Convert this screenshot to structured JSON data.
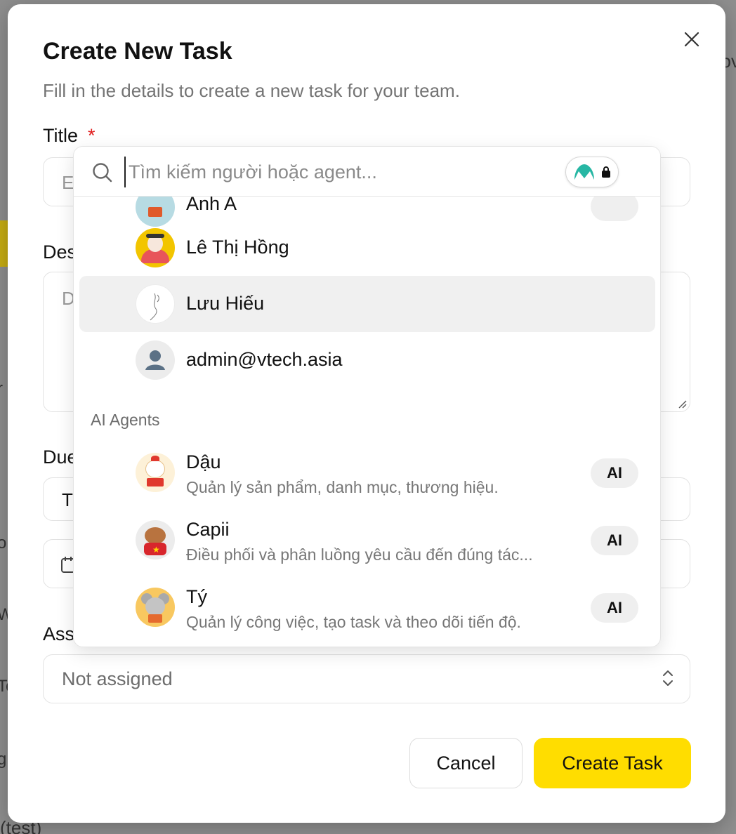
{
  "background": {
    "right_text": "ov",
    "left_glyphs": [
      "r",
      "o",
      "W",
      "To",
      "g"
    ],
    "bottom_text": "(test)"
  },
  "modal": {
    "title": "Create New Task",
    "subtitle": "Fill in the details to create a new task for your team.",
    "title_label": "Title",
    "required_mark": "*",
    "title_placeholder_visible": "E",
    "description_label_visible": "Des",
    "description_placeholder_visible": "D",
    "due_label_visible": "Due",
    "due_type_value_visible": "T",
    "assignee_label_visible": "Ass",
    "assignee": {
      "value": "Not assigned"
    },
    "buttons": {
      "cancel": "Cancel",
      "create": "Create Task"
    }
  },
  "dropdown": {
    "search_placeholder": "Tìm kiếm người hoặc agent...",
    "partial_row_name": "Anh A",
    "people": [
      {
        "name": "Lê Thị Hồng",
        "avatar": "girl-watermelon-avatar"
      },
      {
        "name": "Lưu Hiếu",
        "avatar": "sketch-hand-avatar"
      },
      {
        "name": "admin@vtech.asia",
        "avatar": "default-user-avatar"
      }
    ],
    "section_ai_agents": "AI Agents",
    "agents": [
      {
        "name": "Dậu",
        "description": "Quản lý sản phẩm, danh mục, thương hiệu.",
        "badge": "AI",
        "avatar": "rooster-avatar"
      },
      {
        "name": "Capii",
        "description": "Điều phối và phân luồng yêu cầu đến đúng tác...",
        "badge": "AI",
        "avatar": "capybara-avatar"
      },
      {
        "name": "Tý",
        "description": "Quản lý công việc, tạo task và theo dõi tiến độ.",
        "badge": "AI",
        "avatar": "mouse-avatar"
      }
    ]
  },
  "colors": {
    "primary_button": "#ffdd00",
    "required": "#e11d1d",
    "highlight_row": "#f0f0f0"
  }
}
